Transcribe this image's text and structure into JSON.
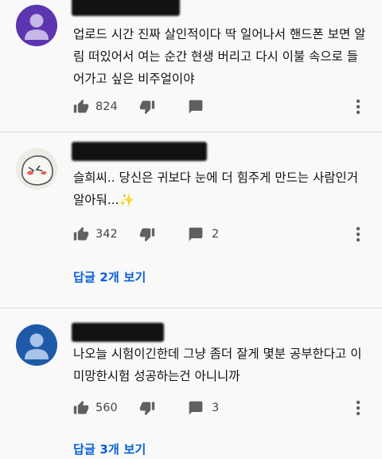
{
  "comments": [
    {
      "text": "업로드 시간 진짜 살인적이다 딱 일어나서 핸드폰 보면 알림 떠있어서 여는 순간 현생 버리고 다시 이불 속으로 들어가고 싶은 비주얼이야",
      "likes": "824",
      "replies_count": "",
      "avatar": "default-avatar-purple"
    },
    {
      "text": "슬희씨.. 당신은 귀보다 눈에 더 힘주게 만드는 사람인거 알아둬...✨",
      "likes": "342",
      "replies_count": "2",
      "view_replies": "답글 2개 보기",
      "avatar": "doodle-avatar"
    },
    {
      "text": "나오늘 시험이긴한데 그냥 좀더 잘게 몇분 공부한다고 이미망한시험 성공하는건 아니니까",
      "likes": "560",
      "replies_count": "3",
      "view_replies": "답글 3개 보기",
      "avatar": "default-avatar-blue"
    }
  ],
  "colors": {
    "link": "#065fd4",
    "background": "#f9f9f9",
    "avatar_purple": "#5e35b1",
    "avatar_blue": "#1e5aa8"
  }
}
